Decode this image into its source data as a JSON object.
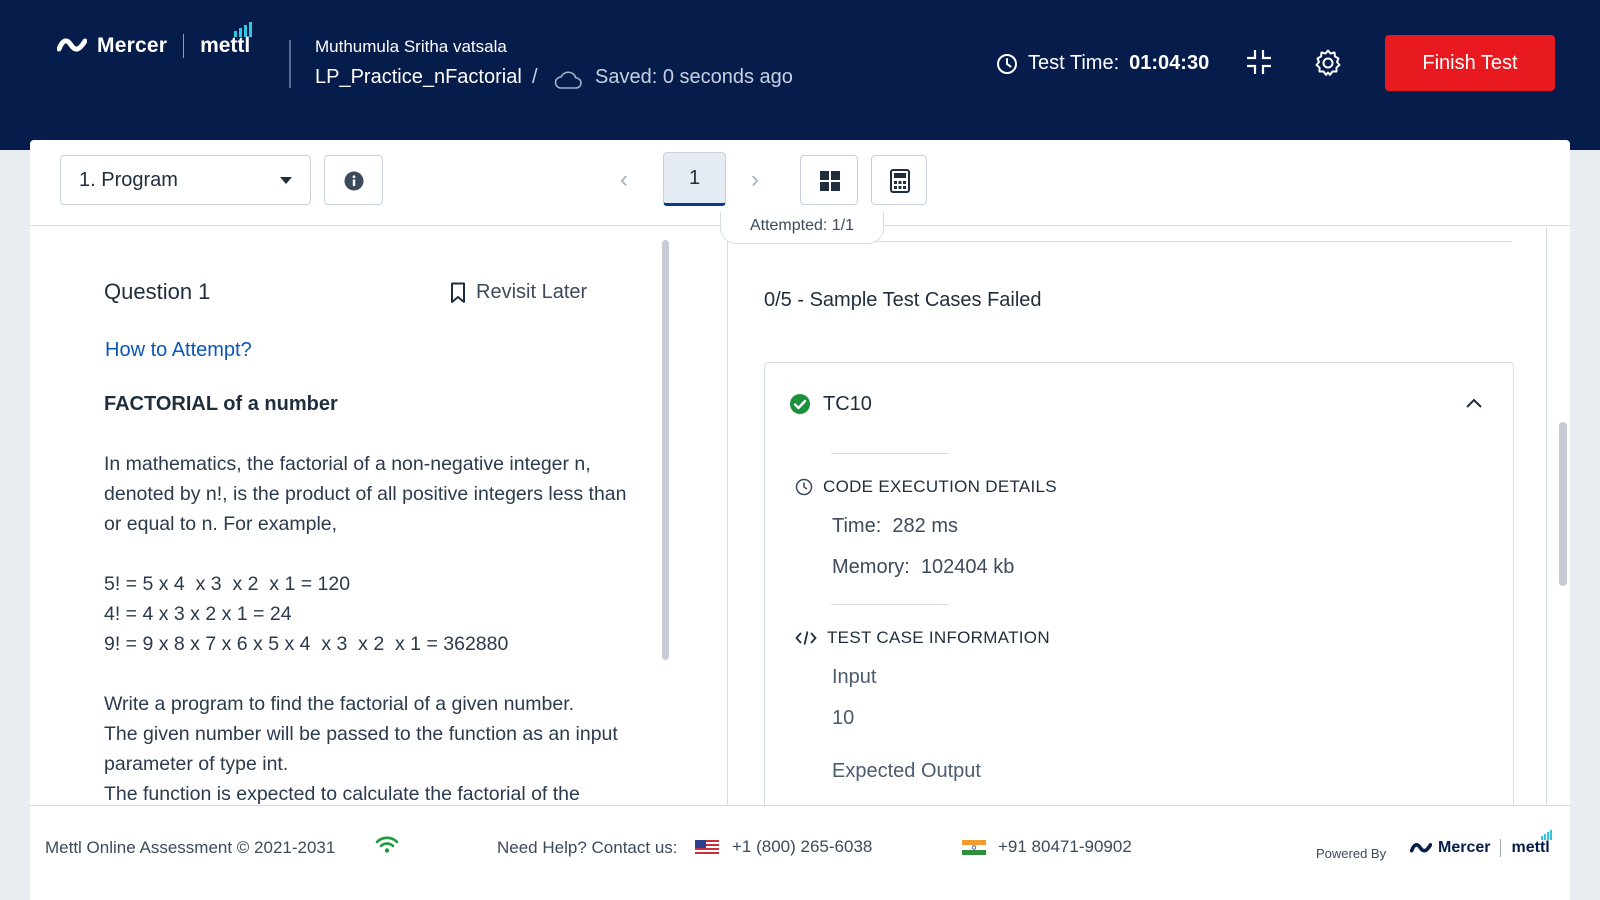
{
  "header": {
    "brand_mercer": "Mercer",
    "brand_mettl": "mettl",
    "user_name": "Muthumula Sritha vatsala",
    "test_title": "LP_Practice_nFactorial",
    "separator": "/",
    "saved_status": "Saved: 0 seconds ago",
    "timer_label": "Test Time:",
    "timer_value": "01:04:30",
    "finish_label": "Finish Test"
  },
  "toolbar": {
    "question_select": "1. Program",
    "prev_arrow": "‹",
    "current_question": "1",
    "next_arrow": "›",
    "attempted": "Attempted: 1/1"
  },
  "question": {
    "title": "Question 1",
    "revisit_label": "Revisit Later",
    "how_to_attempt": "How to Attempt?",
    "heading": "FACTORIAL of a number",
    "intro": "In mathematics, the factorial of a non-negative integer n, denoted by n!, is the product of all positive integers less than or equal to n. For example,",
    "example_1": "5! = 5 x 4  x 3  x 2  x 1 = 120",
    "example_2": "4! = 4 x 3 x 2 x 1 = 24",
    "example_3": "9! = 9 x 8 x 7 x 6 x 5 x 4  x 3  x 2  x 1 = 362880",
    "task_1": "Write a program to find the factorial of a given number.",
    "task_2": "The given number will be passed to the function as an input parameter of type int.",
    "task_3": "The function is expected to calculate the factorial of the"
  },
  "results": {
    "summary": "0/5 - Sample Test Cases Failed",
    "test_case": {
      "name": "TC10",
      "execution_heading": "CODE EXECUTION DETAILS",
      "time_label": "Time:",
      "time_value": "282 ms",
      "memory_label": "Memory:",
      "memory_value": "102404 kb",
      "info_heading": "TEST CASE INFORMATION",
      "input_label": "Input",
      "input_value": "10",
      "expected_label": "Expected Output"
    }
  },
  "footer": {
    "copyright": "Mettl Online Assessment © 2021-2031",
    "help": "Need Help? Contact us:",
    "us_phone": "+1 (800) 265-6038",
    "in_phone": "+91 80471-90902",
    "powered_by": "Powered By",
    "brand_mercer": "Mercer",
    "brand_mettl": "mettl"
  },
  "colors": {
    "header_bg": "#061c4a",
    "finish_button": "#e8191f",
    "link": "#0b57b5",
    "success": "#1a8f3c",
    "accent_bars": "#33c6e4"
  },
  "icons": [
    "mercer-logo-icon",
    "cloud-icon",
    "clock-icon",
    "collapse-icon",
    "gear-icon",
    "caret-down-icon",
    "info-icon",
    "grid-icon",
    "calculator-icon",
    "bookmark-icon",
    "check-circle-icon",
    "chevron-up-icon",
    "code-icon",
    "wifi-icon",
    "us-flag-icon",
    "india-flag-icon"
  ]
}
